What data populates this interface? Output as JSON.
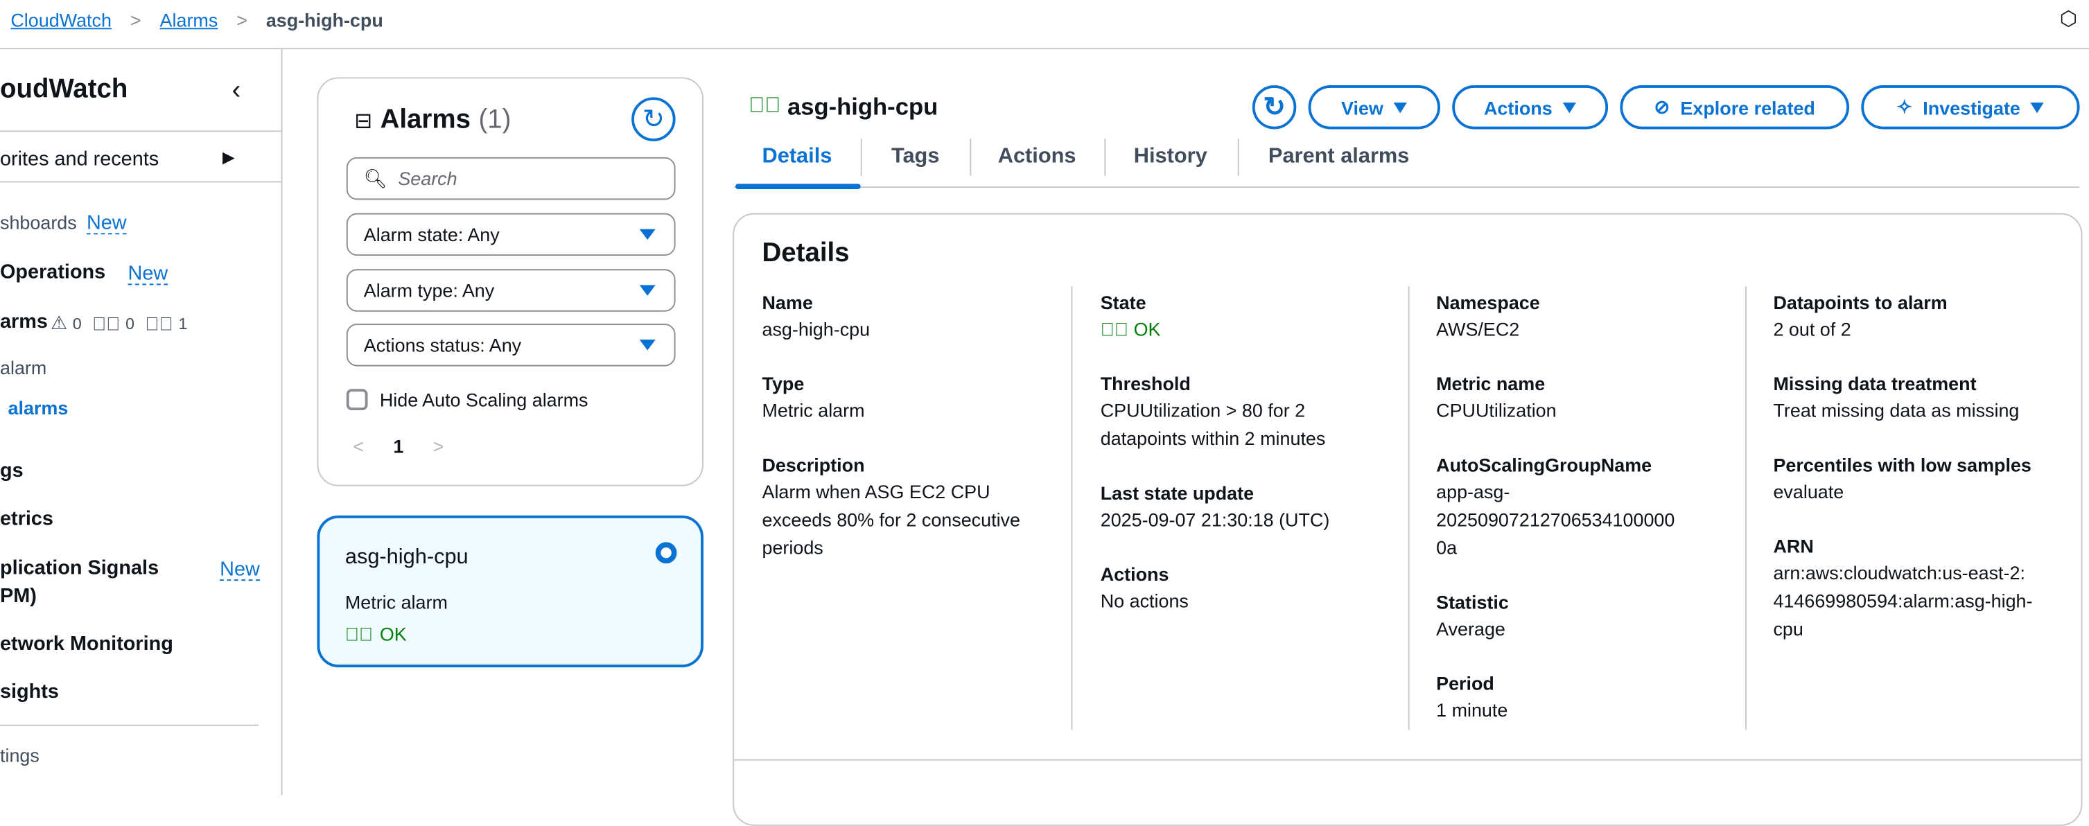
{
  "breadcrumb": {
    "items": [
      "CloudWatch",
      "Alarms"
    ],
    "current": "asg-high-cpu"
  },
  "sidebar": {
    "title": "oudWatch",
    "favorites": "orites and recents",
    "dashboards": "shboards",
    "dashboards_badge": "New",
    "operations": "Operations",
    "operations_badge": "New",
    "alarms": "arms",
    "alarm_counts": {
      "in_alarm": "0",
      "ok": "0",
      "insufficient": "1"
    },
    "in_alarm": "alarm",
    "all_alarms": "alarms",
    "logs": "gs",
    "metrics": "etrics",
    "app_signals_1": "plication Signals",
    "app_signals_2": "PM)",
    "app_signals_badge": "New",
    "network": "etwork Monitoring",
    "insights": "sights",
    "settings": "tings"
  },
  "alarm_list": {
    "title": "Alarms",
    "count": "(1)",
    "search_placeholder": "Search",
    "filters": [
      "Alarm state: Any",
      "Alarm type: Any",
      "Actions status: Any"
    ],
    "hide_asg_label": "Hide Auto Scaling alarms",
    "hide_asg_checked": false,
    "page": "1",
    "items": [
      {
        "name": "asg-high-cpu",
        "type": "Metric alarm",
        "state": "OK",
        "selected": true
      }
    ]
  },
  "header": {
    "title": "asg-high-cpu",
    "buttons": {
      "view": "View",
      "actions": "Actions",
      "explore": "Explore related",
      "investigate": "Investigate"
    }
  },
  "tabs": [
    "Details",
    "Tags",
    "Actions",
    "History",
    "Parent alarms"
  ],
  "active_tab": "Details",
  "details": {
    "heading": "Details",
    "col1": [
      {
        "label": "Name",
        "value": "asg-high-cpu"
      },
      {
        "label": "Type",
        "value": "Metric alarm"
      },
      {
        "label": "Description",
        "value": "Alarm when ASG EC2 CPU exceeds 80% for 2 consecutive periods"
      }
    ],
    "col2": [
      {
        "label": "State",
        "value": "OK"
      },
      {
        "label": "Threshold",
        "value": "CPUUtilization > 80 for 2 datapoints within 2 minutes"
      },
      {
        "label": "Last state update",
        "value": "2025-09-07 21:30:18 (UTC)"
      },
      {
        "label": "Actions",
        "value": "No actions"
      }
    ],
    "col3": [
      {
        "label": "Namespace",
        "value": "AWS/EC2"
      },
      {
        "label": "Metric name",
        "value": "CPUUtilization"
      },
      {
        "label": "AutoScalingGroupName",
        "value": "app-asg-20250907212706534100000 0a"
      },
      {
        "label": "Statistic",
        "value": "Average"
      },
      {
        "label": "Period",
        "value": "1 minute"
      }
    ],
    "col4": [
      {
        "label": "Datapoints to alarm",
        "value": "2 out of 2"
      },
      {
        "label": "Missing data treatment",
        "value": "Treat missing data as missing"
      },
      {
        "label": "Percentiles with low samples",
        "value": "evaluate"
      },
      {
        "label": "ARN",
        "value": "arn:aws:cloudwatch:us-east-2:414669980594:alarm:asg-high-cpu"
      }
    ]
  },
  "colors": {
    "accent": "#0972d3",
    "ok": "#037f0c",
    "selected_bg": "#f0fbff"
  }
}
